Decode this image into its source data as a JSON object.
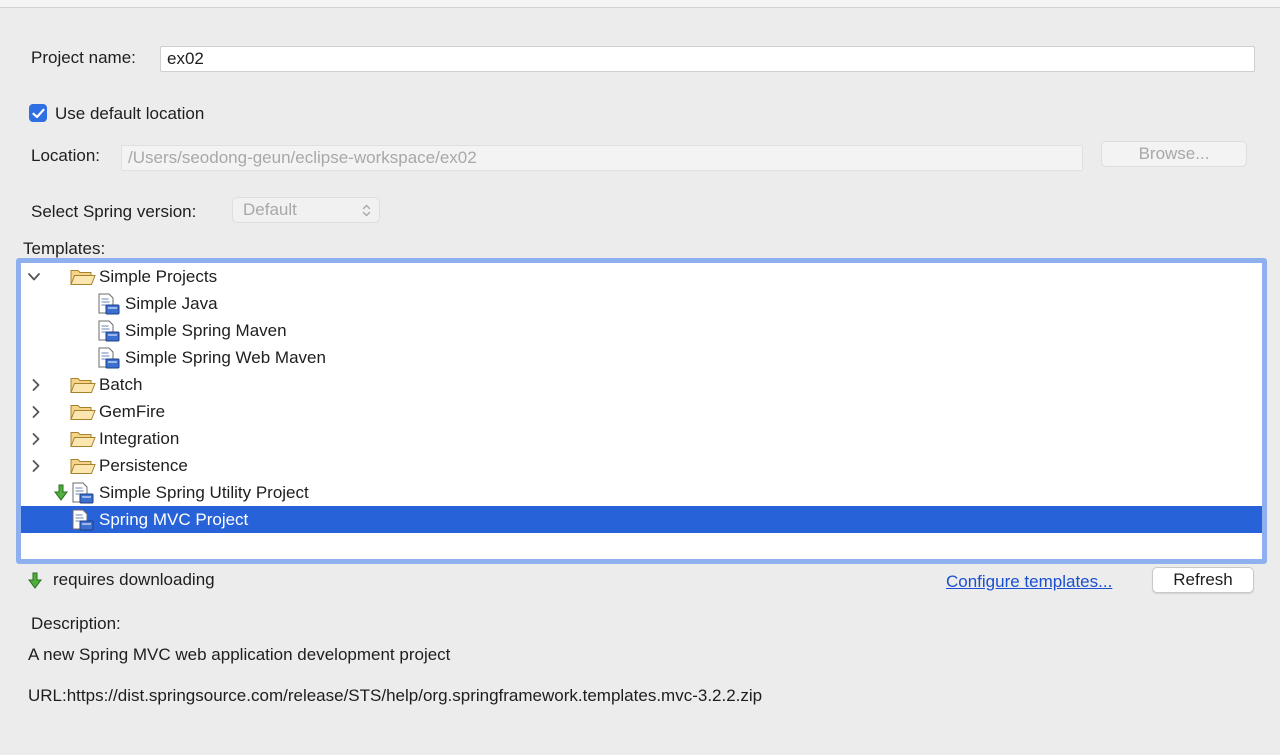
{
  "form": {
    "project_name_label": "Project name:",
    "project_name_value": "ex02",
    "use_default_location_label": "Use default location",
    "use_default_location_checked": true,
    "location_label": "Location:",
    "location_value": "/Users/seodong-geun/eclipse-workspace/ex02",
    "browse_label": "Browse...",
    "spring_version_label": "Select Spring version:",
    "spring_version_value": "Default"
  },
  "templates": {
    "label": "Templates:",
    "items": [
      {
        "label": "Simple Projects",
        "type": "folder",
        "expanded": true
      },
      {
        "label": "Simple Java",
        "type": "template"
      },
      {
        "label": "Simple Spring Maven",
        "type": "template"
      },
      {
        "label": "Simple Spring Web Maven",
        "type": "template"
      },
      {
        "label": "Batch",
        "type": "folder",
        "expanded": false
      },
      {
        "label": "GemFire",
        "type": "folder",
        "expanded": false
      },
      {
        "label": "Integration",
        "type": "folder",
        "expanded": false
      },
      {
        "label": "Persistence",
        "type": "folder",
        "expanded": false
      },
      {
        "label": "Simple Spring Utility Project",
        "type": "template",
        "requires_download": true
      },
      {
        "label": "Spring MVC Project",
        "type": "template",
        "selected": true
      }
    ]
  },
  "legend": {
    "requires_downloading_label": "requires downloading",
    "configure_templates_link": "Configure templates...",
    "refresh_label": "Refresh"
  },
  "description": {
    "label": "Description:",
    "text": "A new Spring MVC web application development project",
    "url_text": "URL:https://dist.springsource.com/release/STS/help/org.springframework.templates.mvc-3.2.2.zip"
  },
  "colors": {
    "selection": "#2762d9",
    "focus_ring": "#8fb0ee",
    "checkbox": "#2f6fe4",
    "link": "#1a4fd1"
  }
}
